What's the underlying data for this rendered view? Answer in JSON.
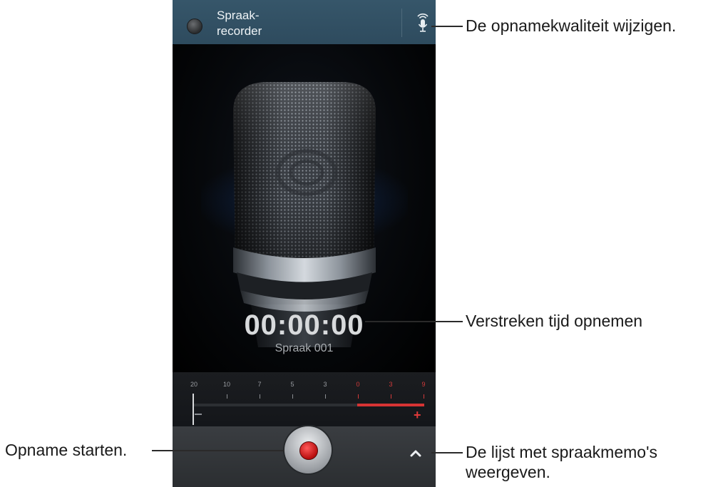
{
  "app": {
    "title": "Spraak-\nrecorder",
    "quality_icon": "mic-quality-icon"
  },
  "recording": {
    "timer": "00:00:00",
    "filename": "Spraak 001"
  },
  "meter": {
    "labels": [
      "20",
      "10",
      "7",
      "5",
      "3",
      "0",
      "3",
      "9"
    ],
    "minus_icon": "minus-icon",
    "plus_icon": "plus-icon",
    "colors": {
      "normal": "#9a9da2",
      "peak": "#d23a3a"
    }
  },
  "controls": {
    "record_icon": "record-icon",
    "list_icon": "chevron-up-icon"
  },
  "callouts": {
    "quality": "De opnamekwaliteit wijzigen.",
    "elapsed": "Verstreken tijd opnemen",
    "start": "Opname starten.",
    "list": "De lijst met spraakmemo's weergeven."
  }
}
